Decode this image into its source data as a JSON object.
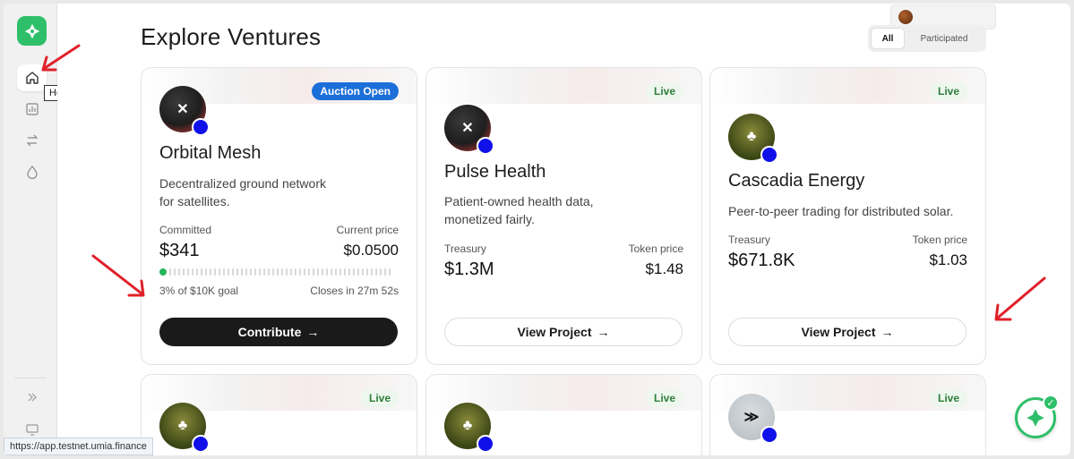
{
  "sidebar": {
    "tooltip": "Home"
  },
  "header": {
    "title": "Explore Ventures",
    "filter_all": "All",
    "filter_participated": "Participated"
  },
  "cards": [
    {
      "badge": "Auction Open",
      "name": "Orbital Mesh",
      "description": "Decentralized ground network for satellites.",
      "left_label": "Committed",
      "left_value": "$341",
      "right_label": "Current price",
      "right_value": "$0.0500",
      "progress_percent": 3,
      "progress_goal": "3% of $10K goal",
      "closes": "Closes in 27m 52s",
      "button": "Contribute"
    },
    {
      "badge": "Live",
      "name": "Pulse Health",
      "description": "Patient-owned health data, monetized fairly.",
      "left_label": "Treasury",
      "left_value": "$1.3M",
      "right_label": "Token price",
      "right_value": "$1.48",
      "button": "View Project"
    },
    {
      "badge": "Live",
      "name": "Cascadia Energy",
      "description": "Peer-to-peer trading for distributed solar.",
      "left_label": "Treasury",
      "left_value": "$671.8K",
      "right_label": "Token price",
      "right_value": "$1.03",
      "button": "View Project"
    },
    {
      "badge": "Live"
    },
    {
      "badge": "Live"
    },
    {
      "badge": "Live"
    }
  ],
  "status_url": "https://app.testnet.umia.finance",
  "colors": {
    "accent_green": "#2fbf6a",
    "auction_blue": "#1c6fd8",
    "annotation_red": "#e0202a"
  }
}
